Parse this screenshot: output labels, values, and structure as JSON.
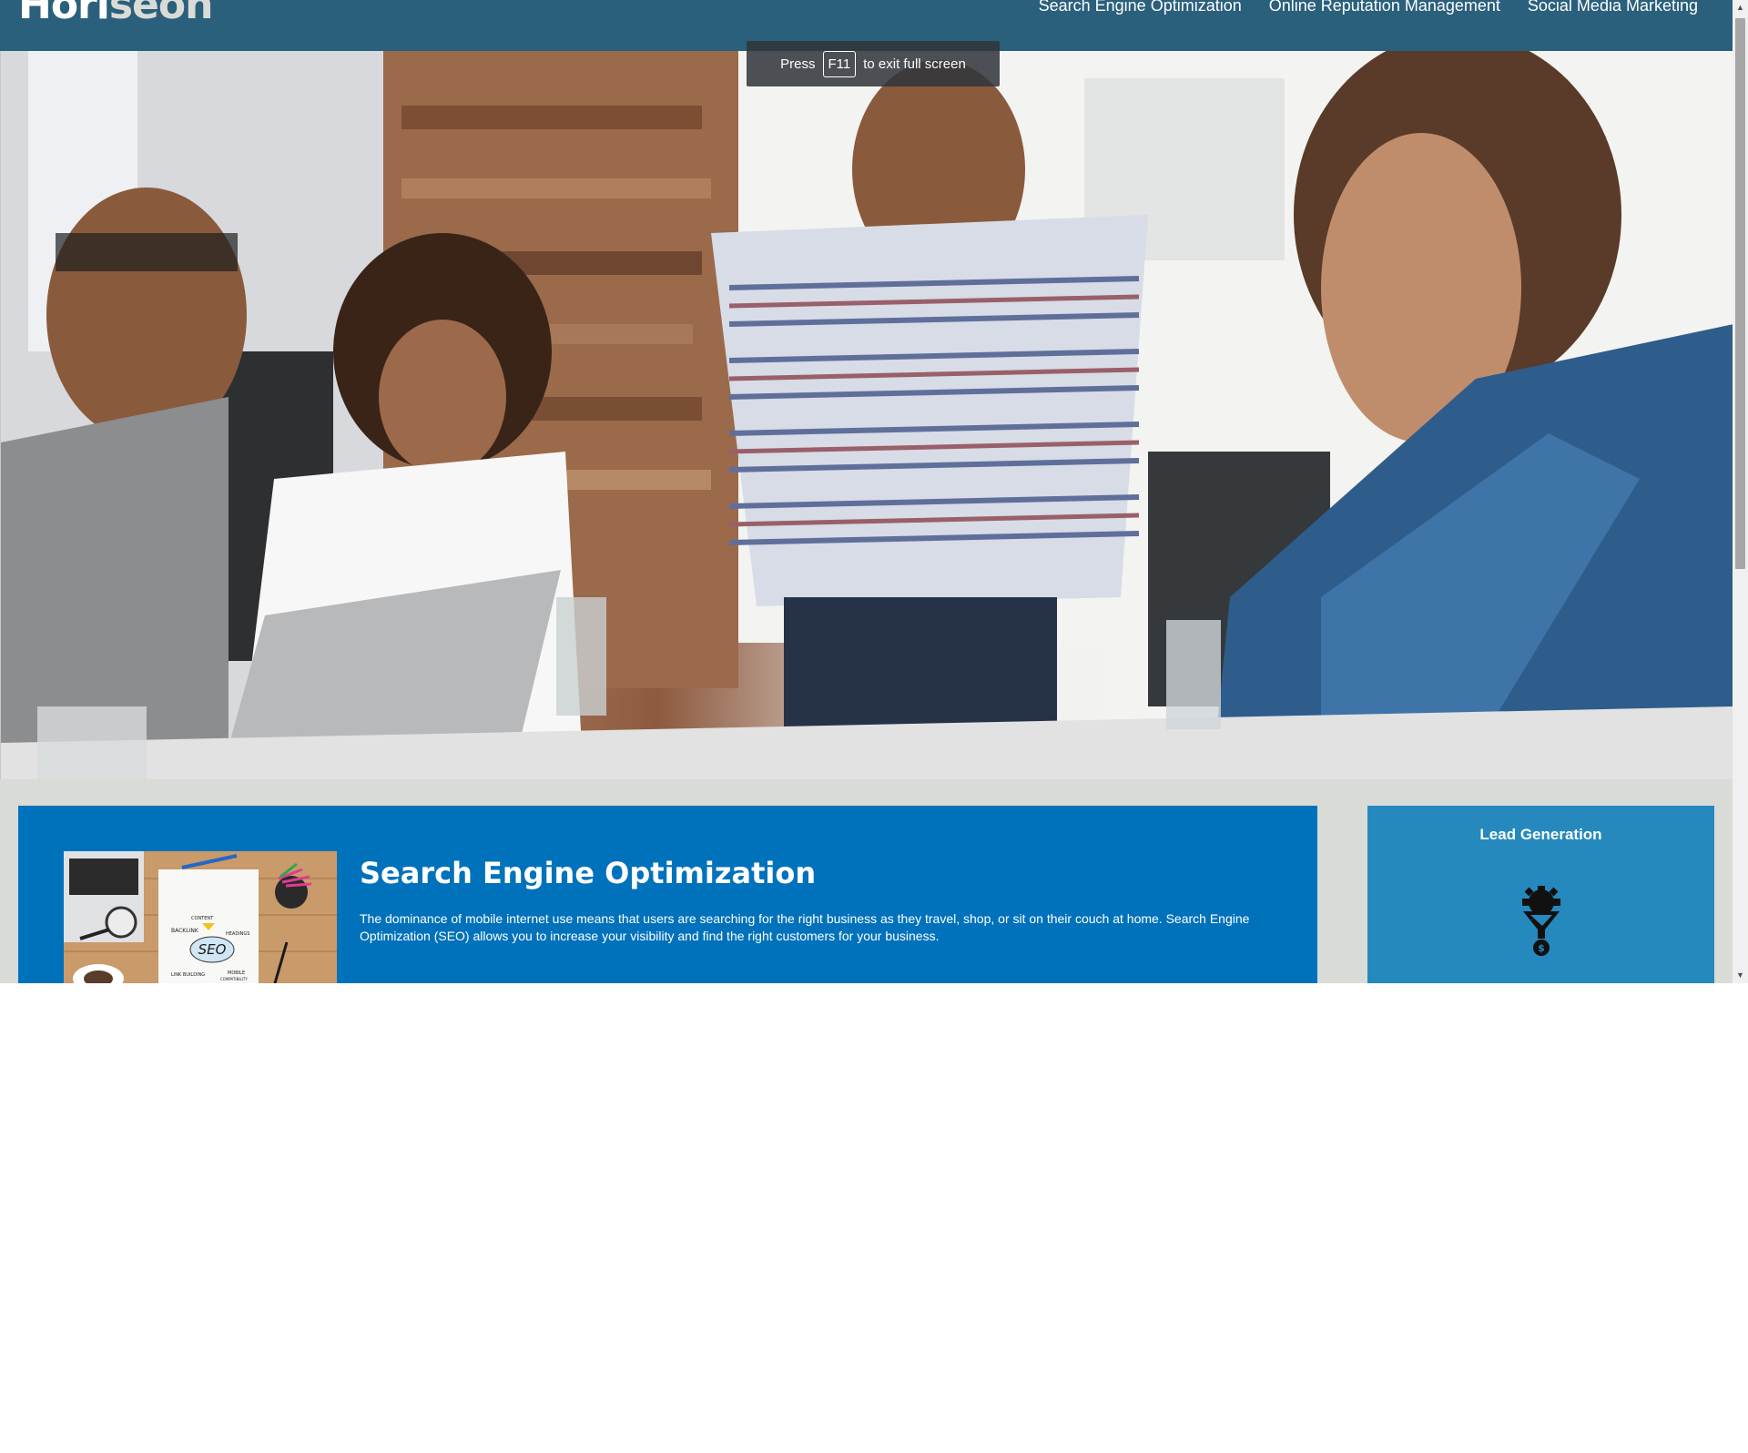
{
  "header": {
    "brand_part1": "Hori",
    "brand_part2": "seon",
    "nav": [
      {
        "label": "Search Engine Optimization"
      },
      {
        "label": "Online Reputation Management"
      },
      {
        "label": "Social Media Marketing"
      }
    ]
  },
  "fullscreen_toast": {
    "press": "Press",
    "key": "F11",
    "message": "to exit full screen"
  },
  "seo_section": {
    "title": "Search Engine Optimization",
    "text": "The dominance of mobile internet use means that users are searching for the right business as they travel, shop, or sit on their couch at home. Search Engine Optimization (SEO) allows you to increase your visibility and find the right customers for your business.",
    "image_words": {
      "seo": "SEO",
      "content": "CONTENT",
      "backlink": "BACKLINK",
      "headings": "HEADINGS",
      "link_building": "LINK BUILDING",
      "mobile": "MOBILE",
      "compatibility": "COMPATIBILITY"
    }
  },
  "lead_section": {
    "title": "Lead Generation",
    "icon": "gear-funnel-dollar-icon"
  },
  "colors": {
    "header": "#2a607c",
    "background": "#d9dbd6",
    "seo_card": "#0072bb",
    "lead_card": "#2589bd"
  }
}
